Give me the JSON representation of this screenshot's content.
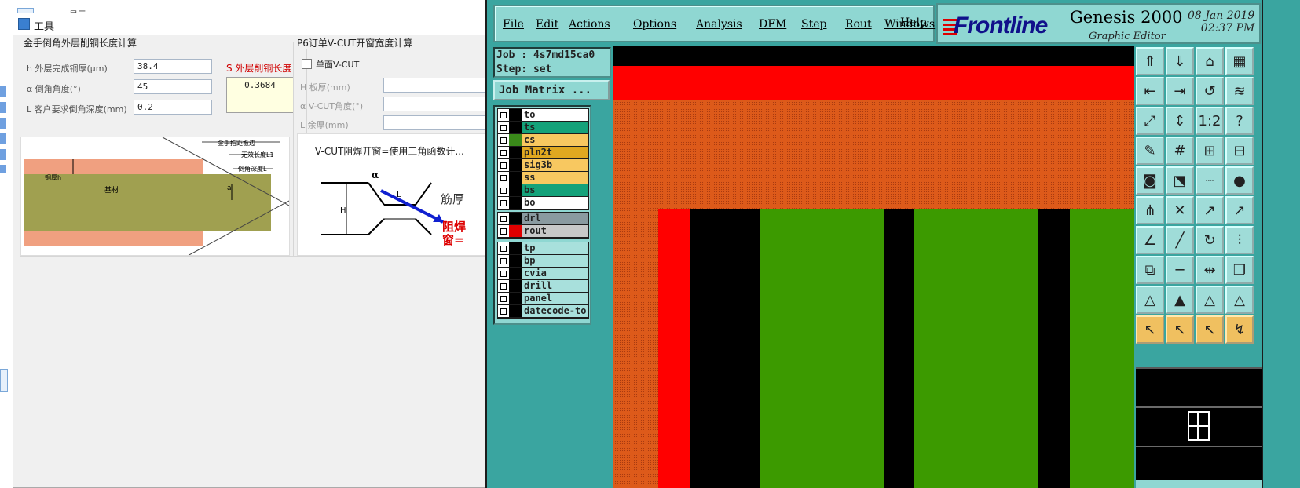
{
  "background_app": {
    "tab_label": "...",
    "checkbox_text": "显示..."
  },
  "tool_window": {
    "title": "工具",
    "left_group": {
      "title": "金手倒角外层削铜长度计算",
      "h_label": "h 外层完成铜厚(μm)",
      "h_value": "38.4",
      "alpha_label": "α 倒角角度(°)",
      "alpha_value": "45",
      "L_label": "L 客户要求倒角深度(mm)",
      "L_value": "0.2",
      "result_label": "S 外层削铜长度",
      "result_value": "0.3684",
      "diagram": {
        "label_top": "金手指距板边",
        "label_wuxiao": "无效长度L1",
        "label_daojiao": "倒角深度L",
        "label_tonghou": "铜厚h",
        "label_jicai": "基材",
        "label_a": "a"
      }
    },
    "right_group": {
      "title": "P6订单V-CUT开窗宽度计算",
      "single_vcut_label": "单面V-CUT",
      "board_thickness_label": "H 板厚(mm)",
      "vcut_angle_label": "α V-CUT角度(°)",
      "remaining_thickness_label": "L 余厚(mm)",
      "diagram": {
        "caption": "V-CUT阻焊开窗=使用三角函数计...",
        "label_jinhou": "筋厚",
        "label_zuhan": "阻焊",
        "label_chuang": "窗=",
        "label_alpha": "α",
        "label_H": "H",
        "label_L": "L"
      }
    }
  },
  "genesis": {
    "menu": [
      "File",
      "Edit",
      "Actions",
      "Options",
      "Analysis",
      "DFM",
      "Step",
      "Rout",
      "Windows",
      "Help"
    ],
    "brand": {
      "logo": "Frontline",
      "product": "Genesis 2000",
      "subtitle": "Graphic Editor",
      "date": "08 Jan 2019",
      "time": "02:37 PM"
    },
    "job_label": "Job : 4s7md15ca0",
    "step_label": "Step: set",
    "job_matrix_button": "Job Matrix ...",
    "layer_groups": [
      [
        {
          "name": "to",
          "swatch": "#000000",
          "bg": "#ffffff"
        },
        {
          "name": "ts",
          "swatch": "#000000",
          "bg": "#14a27a"
        },
        {
          "name": "cs",
          "swatch": "#3a8a1a",
          "bg": "#f8c860"
        },
        {
          "name": "pln2t",
          "swatch": "#000000",
          "bg": "#e0a820"
        },
        {
          "name": "sig3b",
          "swatch": "#000000",
          "bg": "#f8c860"
        },
        {
          "name": "ss",
          "swatch": "#000000",
          "bg": "#f8c860"
        },
        {
          "name": "bs",
          "swatch": "#000000",
          "bg": "#14a27a"
        },
        {
          "name": "bo",
          "swatch": "#000000",
          "bg": "#ffffff"
        }
      ],
      [
        {
          "name": "drl",
          "swatch": "#000000",
          "bg": "#8a9aa0"
        },
        {
          "name": "rout",
          "swatch": "#e00000",
          "bg": "#c8c8c8"
        }
      ],
      [
        {
          "name": "tp",
          "swatch": "#000000",
          "bg": "#a8e0dc"
        },
        {
          "name": "bp",
          "swatch": "#000000",
          "bg": "#a8e0dc"
        },
        {
          "name": "cvia",
          "swatch": "#000000",
          "bg": "#a8e0dc"
        },
        {
          "name": "drill",
          "swatch": "#000000",
          "bg": "#a8e0dc"
        },
        {
          "name": "panel",
          "swatch": "#000000",
          "bg": "#a8e0dc"
        },
        {
          "name": "datecode-to",
          "swatch": "#000000",
          "bg": "#a8e0dc"
        }
      ]
    ],
    "toolbox_icons": [
      "zoom-up-icon",
      "zoom-down-icon",
      "home-icon",
      "window-icon",
      "pan-left-icon",
      "pan-right-icon",
      "snap-icon",
      "redraw-icon",
      "fit-screen-icon",
      "fit-vertical-icon",
      "scale-icon",
      "help-icon",
      "measure-tool-icon",
      "grid-icon",
      "layer-red-icon",
      "layer-red-2-icon",
      "pad-icon",
      "select-box-icon",
      "ruler-icon",
      "point-icon",
      "net-icon",
      "cross-icon",
      "add-line-icon",
      "add-arc-icon",
      "angle-icon",
      "slash-icon",
      "undo-icon",
      "ff-icon",
      "move-icon",
      "minus-icon",
      "resize-icon",
      "copy-icon",
      "triangle-icon",
      "arrow-up-icon",
      "up-a-icon",
      "up-b-icon",
      "select-arrow-icon",
      "select-arrow-2-icon",
      "select-arrow-3-icon",
      "route-icon"
    ],
    "colors": {
      "panel": "#3aa5a0",
      "accent": "#8fd7d2",
      "canvas_orange": "#dd5a1a",
      "canvas_red": "#ff0000",
      "canvas_green": "#3c9a00"
    }
  }
}
